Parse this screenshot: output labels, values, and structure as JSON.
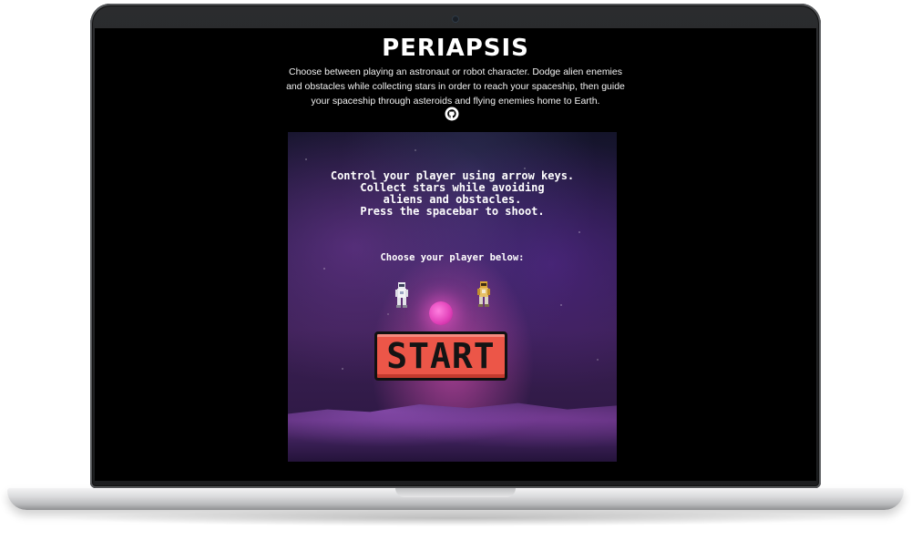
{
  "site": {
    "title": "PERIAPSIS",
    "description": "Choose between playing an astronaut or robot character. Dodge alien enemies and obstacles while collecting stars in order to reach your spaceship, then guide your spaceship through asteroids and flying enemies home to Earth.",
    "github_icon": "github-icon"
  },
  "game": {
    "instructions": "Control your player using arrow keys.\nCollect stars while avoiding\naliens and obstacles.\nPress the spacebar to shoot.",
    "choose_prompt": "Choose your player below:",
    "characters": [
      {
        "name": "astronaut",
        "icon": "astronaut-icon"
      },
      {
        "name": "robot",
        "icon": "robot-icon"
      }
    ],
    "start_label": "START"
  },
  "colors": {
    "screen_bg": "#000000",
    "start_button": "#ec5648",
    "planet": "#e040b8"
  }
}
